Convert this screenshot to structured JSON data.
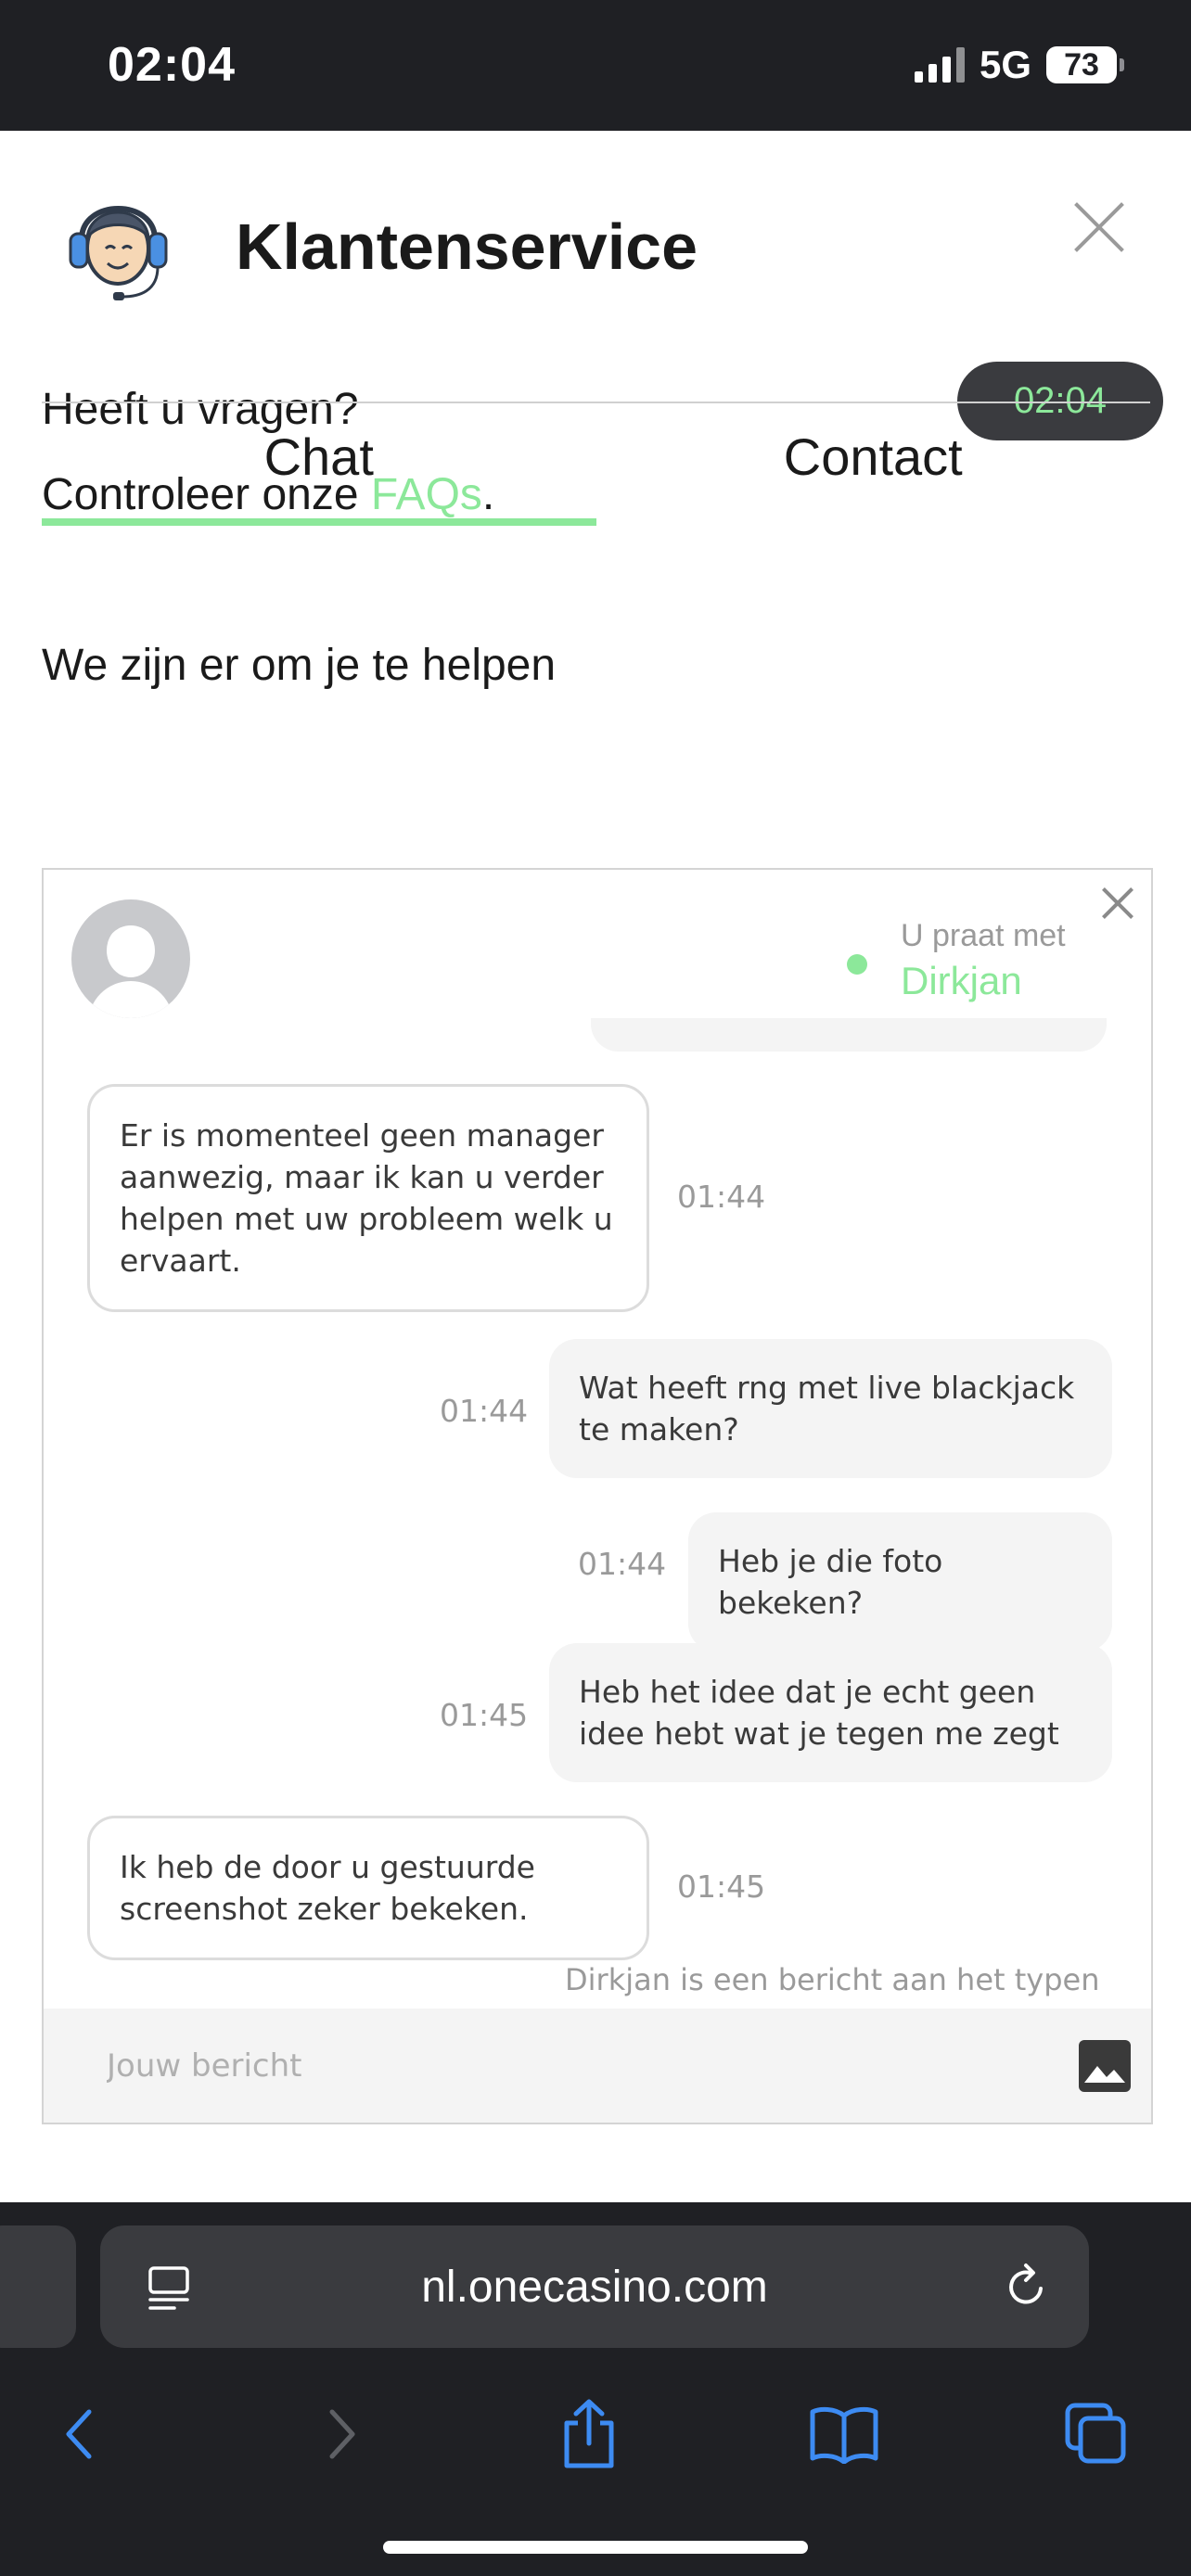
{
  "status_bar": {
    "time": "02:04",
    "network": "5G",
    "battery": "73"
  },
  "header": {
    "title": "Klantenservice",
    "faq_line1": "Heeft u vragen?",
    "faq_line2_prefix": "Controleer onze ",
    "faq_link": "FAQs",
    "faq_line2_suffix": ".",
    "time_pill": "02:04"
  },
  "tabs": [
    {
      "label": "Chat",
      "active": true
    },
    {
      "label": "Contact",
      "active": false
    }
  ],
  "help_heading": "We zijn er om je te helpen",
  "chat": {
    "talking_label": "U praat met",
    "agent_name": "Dirkjan",
    "messages": [
      {
        "direction": "in",
        "text": "Er is momenteel geen manager aanwezig, maar ik kan u verder helpen met uw probleem welk u ervaart.",
        "time": "01:44"
      },
      {
        "direction": "out",
        "text": "Wat heeft rng met live blackjack te maken?",
        "time": "01:44"
      },
      {
        "direction": "out",
        "text": "Heb je die foto bekeken?",
        "time": "01:44"
      },
      {
        "direction": "out",
        "text": "Heb het idee dat je echt geen idee hebt wat je tegen me zegt",
        "time": "01:45"
      },
      {
        "direction": "in",
        "text": "Ik heb de door u gestuurde screenshot zeker bekeken.",
        "time": "01:45"
      }
    ],
    "typing_indicator": "Dirkjan is een bericht aan het typen",
    "composer_placeholder": "Jouw bericht"
  },
  "browser": {
    "url": "nl.onecasino.com"
  },
  "colors": {
    "accent": "#8ce89a",
    "dark": "#1f2024",
    "pill": "#3a3b3f",
    "ios_blue": "#3d8bf2"
  }
}
